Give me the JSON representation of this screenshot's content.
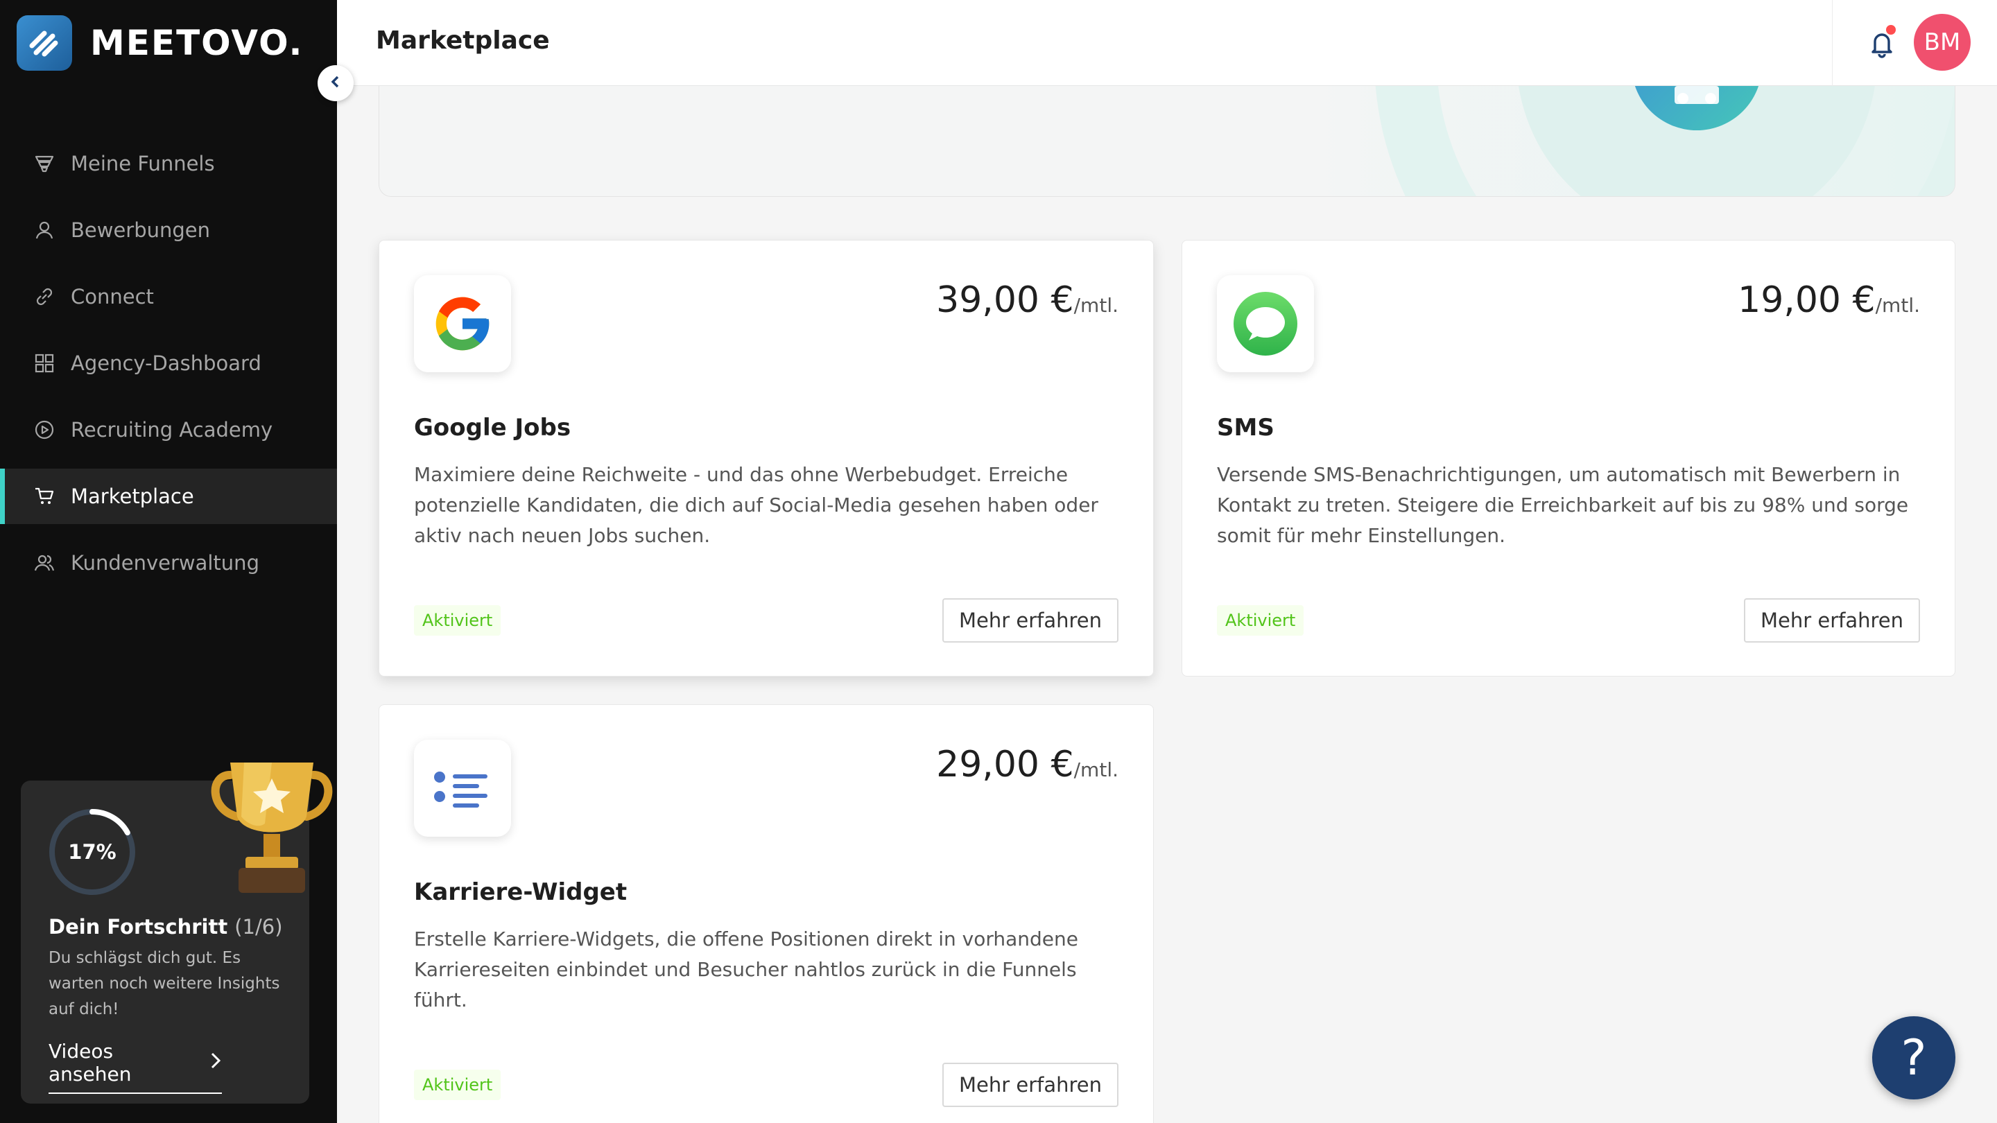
{
  "app": {
    "logo_text": "MEETOVO."
  },
  "header": {
    "title": "Marketplace",
    "avatar_initials": "BM"
  },
  "sidebar": {
    "items": [
      {
        "label": "Meine Funnels",
        "icon": "funnel-icon"
      },
      {
        "label": "Bewerbungen",
        "icon": "user-icon"
      },
      {
        "label": "Connect",
        "icon": "link-icon"
      },
      {
        "label": "Agency-Dashboard",
        "icon": "grid-icon"
      },
      {
        "label": "Recruiting Academy",
        "icon": "play-circle-icon"
      },
      {
        "label": "Marketplace",
        "icon": "cart-icon",
        "active": true
      },
      {
        "label": "Kundenverwaltung",
        "icon": "users-icon"
      }
    ],
    "progress": {
      "percent_label": "17%",
      "percent": 17,
      "title": "Dein Fortschritt",
      "count": "(1/6)",
      "description": "Du schlägst dich gut. Es warten noch weitere Insights auf dich!",
      "link": "Videos ansehen"
    }
  },
  "cards": [
    {
      "price": "39,00 €",
      "period": "/mtl.",
      "title": "Google Jobs",
      "description": "Maximiere deine Reichweite - und das ohne Werbebudget. Erreiche potenzielle Kandidaten, die dich auf Social-Media gesehen haben oder aktiv nach neuen Jobs suchen.",
      "status": "Aktiviert",
      "button": "Mehr erfahren",
      "icon": "google-icon"
    },
    {
      "price": "19,00 €",
      "period": "/mtl.",
      "title": "SMS",
      "description": "Versende SMS-Benachrichtigungen, um automatisch mit Bewerbern in Kontakt zu treten. Steigere die Erreichbarkeit auf bis zu 98% und sorge somit für mehr Einstellungen.",
      "status": "Aktiviert",
      "button": "Mehr erfahren",
      "icon": "message-bubble-icon"
    },
    {
      "price": "29,00 €",
      "period": "/mtl.",
      "title": "Karriere-Widget",
      "description": "Erstelle Karriere-Widgets, die offene Positionen direkt in vorhandene Karriereseiten einbindet und Besucher nahtlos zurück in die Funnels führt.",
      "status": "Aktiviert",
      "button": "Mehr erfahren",
      "icon": "list-icon"
    }
  ],
  "help": {
    "label": "?"
  },
  "colors": {
    "accent": "#3fd2c7",
    "active_green": "#52c41a",
    "avatar": "#f0506e",
    "help_button": "#1e3f70"
  }
}
